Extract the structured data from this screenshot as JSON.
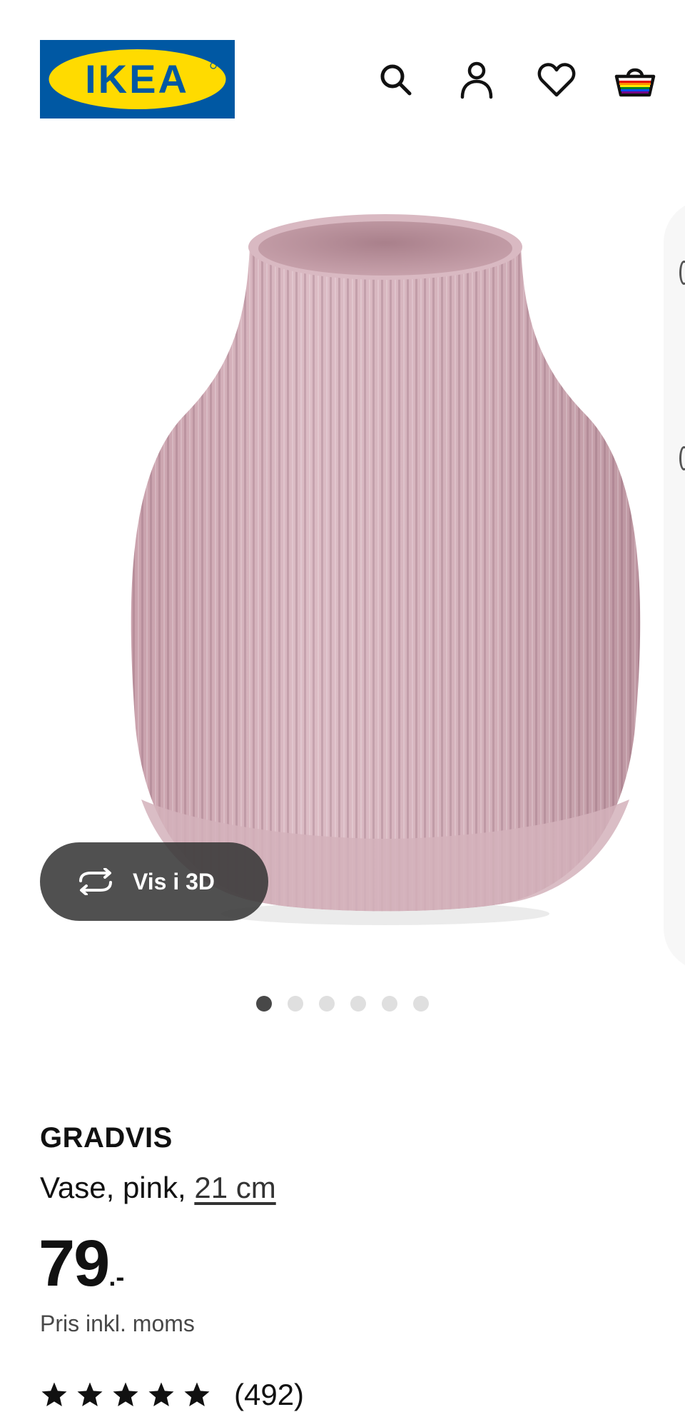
{
  "header": {
    "logo_text": "IKEA",
    "icons": [
      "search-icon",
      "account-icon",
      "heart-icon",
      "basket-icon"
    ]
  },
  "gallery": {
    "view_3d_label": "Vis i 3D",
    "slide_count": 6,
    "active_slide": 1
  },
  "product": {
    "name": "GRADVIS",
    "description": "Vase, pink, ",
    "size": "21 cm",
    "price_integer": "79",
    "price_suffix": ".-",
    "vat_note": "Pris inkl. moms",
    "rating_stars": 5,
    "review_count": "(492)"
  },
  "colors": {
    "brand_blue": "#0058a3",
    "brand_yellow": "#ffdb00",
    "vase_pink": "#d6b3bd"
  }
}
